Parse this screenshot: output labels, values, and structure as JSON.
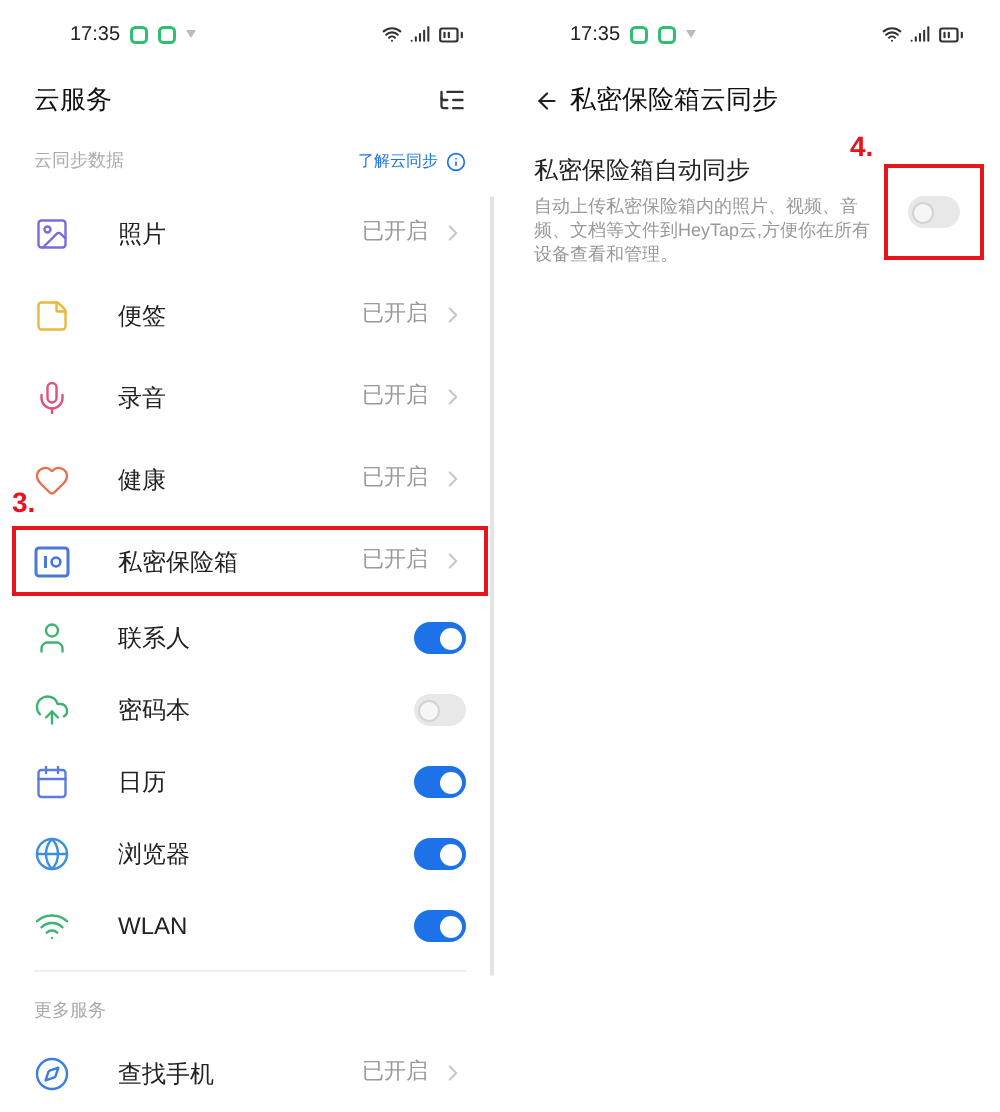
{
  "left_screen": {
    "status_bar": {
      "time": "17:35"
    },
    "title": "云服务",
    "section": "云同步数据",
    "help_link": "了解云同步",
    "items": [
      {
        "kind": "status",
        "label": "照片",
        "status": "已开启",
        "highlighted": false
      },
      {
        "kind": "status",
        "label": "便签",
        "status": "已开启",
        "highlighted": false
      },
      {
        "kind": "status",
        "label": "录音",
        "status": "已开启",
        "highlighted": false
      },
      {
        "kind": "status",
        "label": "健康",
        "status": "已开启",
        "highlighted": false
      },
      {
        "kind": "status",
        "label": "私密保险箱",
        "status": "已开启",
        "highlighted": true,
        "step": "3."
      },
      {
        "kind": "toggle",
        "label": "联系人",
        "on": true
      },
      {
        "kind": "toggle",
        "label": "密码本",
        "on": false
      },
      {
        "kind": "toggle",
        "label": "日历",
        "on": true
      },
      {
        "kind": "toggle",
        "label": "浏览器",
        "on": true
      },
      {
        "kind": "toggle",
        "label": "WLAN",
        "on": true
      }
    ],
    "more_section": "更多服务",
    "more_items": [
      {
        "kind": "status",
        "label": "查找手机",
        "status": "已开启",
        "highlighted": false
      }
    ]
  },
  "right_screen": {
    "status_bar": {
      "time": "17:35"
    },
    "title": "私密保险箱云同步",
    "step": "4.",
    "setting": {
      "label": "私密保险箱自动同步",
      "description": "自动上传私密保险箱内的照片、视频、音频、文档等文件到HeyTap云,方便你在所有设备查看和管理。",
      "on": false,
      "highlighted": true
    }
  }
}
